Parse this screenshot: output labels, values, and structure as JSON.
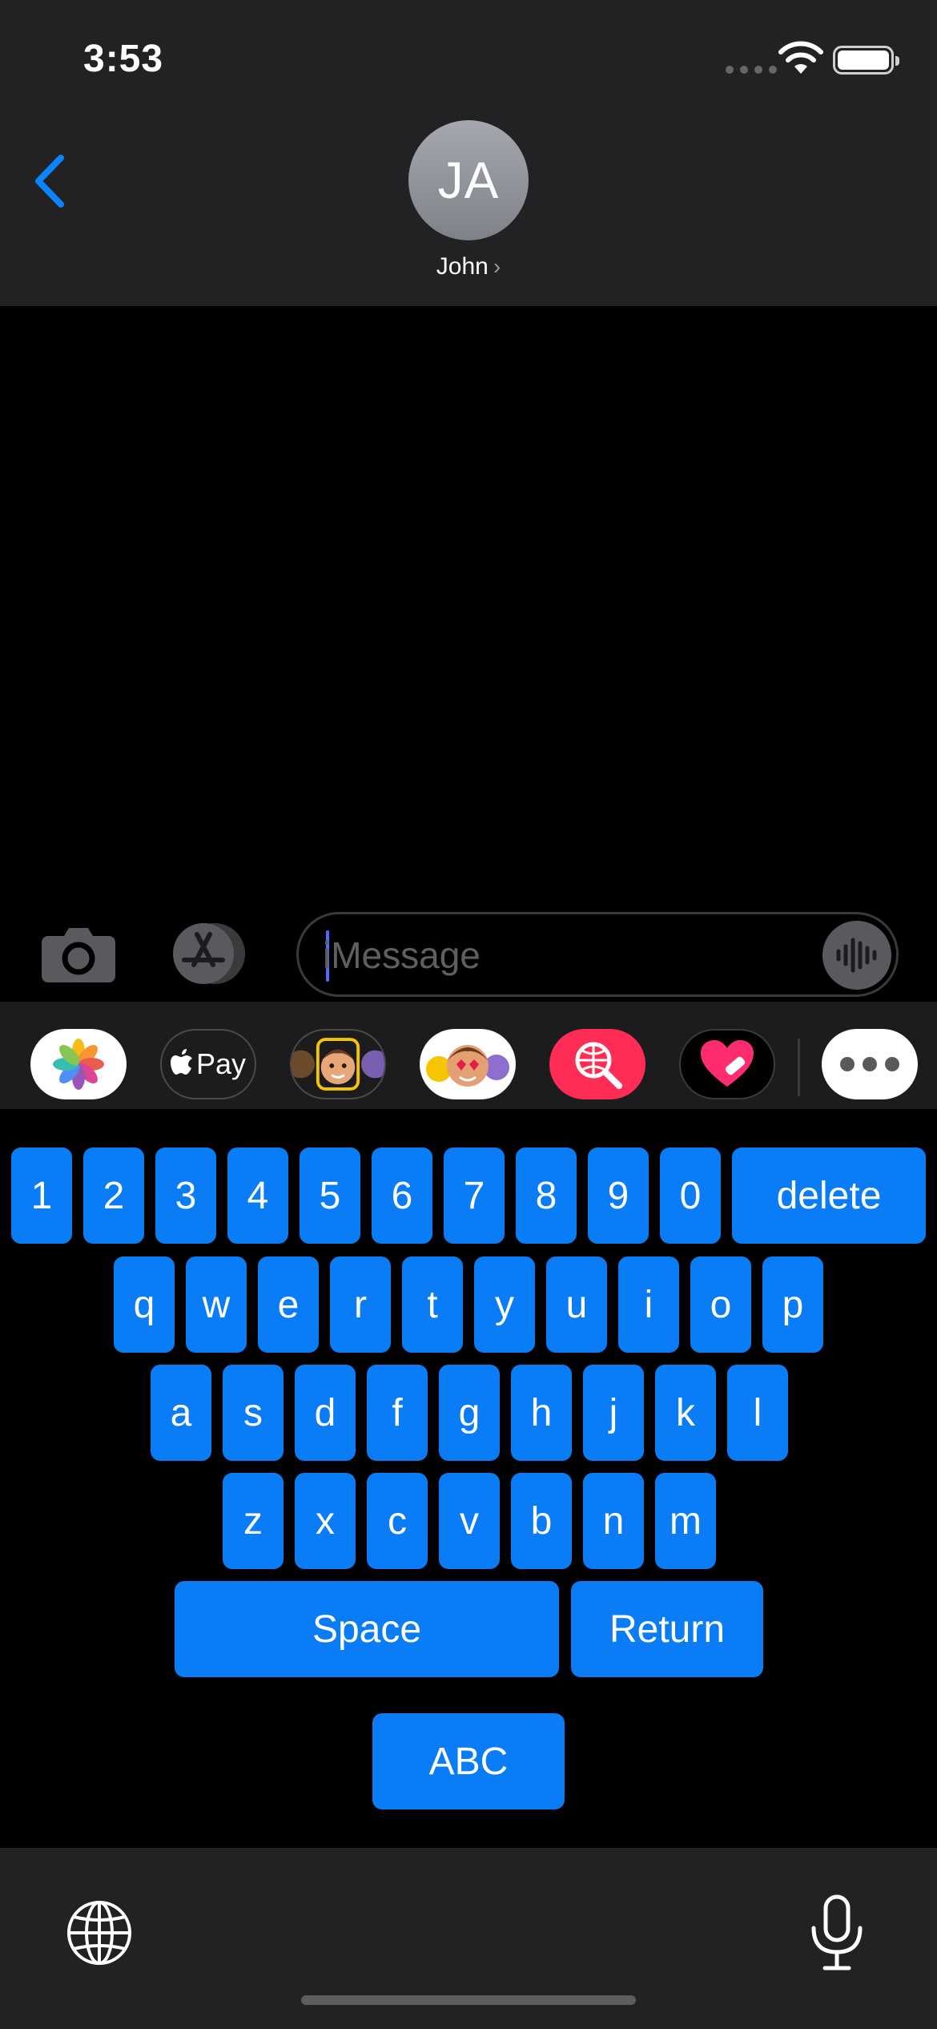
{
  "status_bar": {
    "time": "3:53"
  },
  "header": {
    "avatar_initials": "JA",
    "contact_name": "John",
    "chevron": "›"
  },
  "compose": {
    "placeholder": "iMessage",
    "value": ""
  },
  "app_strip": {
    "items": [
      {
        "name": "photos-app",
        "icon": "photos-icon",
        "label": ""
      },
      {
        "name": "apple-pay-app",
        "icon": "apple-pay-icon",
        "label": "Pay"
      },
      {
        "name": "memoji-stickers-app",
        "icon": "memoji-icon",
        "label": ""
      },
      {
        "name": "animoji-app",
        "icon": "animoji-icon",
        "label": ""
      },
      {
        "name": "images-search-app",
        "icon": "globe-search-icon",
        "label": ""
      },
      {
        "name": "digital-touch-app",
        "icon": "heart-icon",
        "label": ""
      },
      {
        "name": "more-apps",
        "icon": "more-icon",
        "label": ""
      }
    ]
  },
  "keyboard": {
    "row1": [
      "1",
      "2",
      "3",
      "4",
      "5",
      "6",
      "7",
      "8",
      "9",
      "0"
    ],
    "delete": "delete",
    "row2": [
      "q",
      "w",
      "e",
      "r",
      "t",
      "y",
      "u",
      "i",
      "o",
      "p"
    ],
    "row3": [
      "a",
      "s",
      "d",
      "f",
      "g",
      "h",
      "j",
      "k",
      "l"
    ],
    "row4": [
      "z",
      "x",
      "c",
      "v",
      "b",
      "n",
      "m"
    ],
    "space": "Space",
    "return": "Return",
    "abc": "ABC"
  },
  "colors": {
    "key_blue": "#0a7cf5",
    "accent_blue": "#0a84ff",
    "header_bg": "#222224",
    "strip_bg": "#1c1c1e"
  }
}
